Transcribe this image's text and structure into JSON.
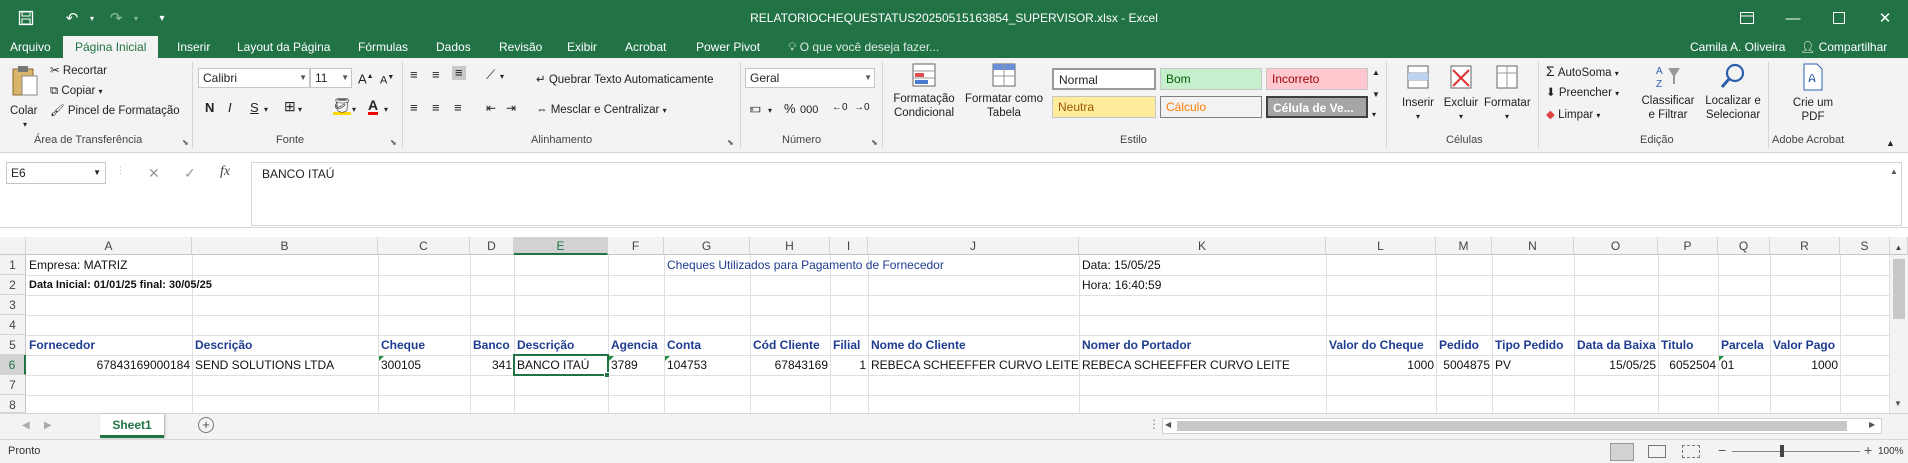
{
  "window": {
    "title": "RELATORIOCHEQUESTATUS20250515163854_SUPERVISOR.xlsx  -  Excel"
  },
  "tabs": [
    "Arquivo",
    "Página Inicial",
    "Inserir",
    "Layout da Página",
    "Fórmulas",
    "Dados",
    "Revisão",
    "Exibir",
    "Acrobat",
    "Power Pivot"
  ],
  "tell_me": "O que você deseja fazer...",
  "user": "Camila A. Oliveira",
  "share_label": "Compartilhar",
  "ribbon": {
    "clipboard": {
      "paste": "Colar",
      "cut": "Recortar",
      "copy": "Copiar",
      "painter": "Pincel de Formatação",
      "label": "Área de Transferência"
    },
    "font": {
      "name": "Calibri",
      "size": "11",
      "label": "Fonte",
      "bold": "N",
      "italic": "I",
      "underline": "S"
    },
    "alignment": {
      "wrap": "Quebrar Texto Automaticamente",
      "merge": "Mesclar e Centralizar",
      "label": "Alinhamento"
    },
    "number": {
      "format": "Geral",
      "label": "Número",
      "percent": "%",
      "thousands": "000"
    },
    "styles": {
      "cond_format": "Formatação Condicional",
      "format_table": "Formatar como Tabela",
      "normal": "Normal",
      "good": "Bom",
      "bad": "Incorreto",
      "neutral": "Neutra",
      "calc": "Cálculo",
      "check": "Célula de Ve...",
      "label": "Estilo"
    },
    "cells": {
      "insert": "Inserir",
      "delete": "Excluir",
      "format": "Formatar",
      "label": "Células"
    },
    "editing": {
      "autosum": "AutoSoma",
      "fill": "Preencher",
      "clear": "Limpar",
      "sort": "Classificar e Filtrar",
      "find": "Localizar e Selecionar",
      "label": "Edição"
    },
    "acrobat": {
      "create": "Crie um PDF",
      "label": "Adobe Acrobat"
    }
  },
  "formula_bar": {
    "name_box": "E6",
    "formula": "BANCO ITAÚ"
  },
  "columns": [
    "A",
    "B",
    "C",
    "D",
    "E",
    "F",
    "G",
    "H",
    "I",
    "J",
    "K",
    "L",
    "M",
    "N",
    "O",
    "P",
    "Q",
    "R",
    "S"
  ],
  "rows": [
    "1",
    "2",
    "3",
    "4",
    "5",
    "6",
    "7",
    "8"
  ],
  "cells": {
    "A1": "Empresa: MATRIZ",
    "G1": "Cheques Utilizados para Pagamento de Fornecedor",
    "K1": "Data: 15/05/25",
    "A2": "Data Inicial: 01/01/25 final: 30/05/25",
    "K2": "Hora: 16:40:59",
    "headers": [
      "Fornecedor",
      "Descrição",
      "Cheque",
      "Banco",
      "Descrição",
      "Agencia",
      "Conta",
      "Cód Cliente",
      "Filial",
      "Nome do Cliente",
      "Nomer do Portador",
      "Valor do Cheque",
      "Pedido",
      "Tipo Pedido",
      "Data da Baixa",
      "Titulo",
      "Parcela",
      "Valor Pago"
    ],
    "row6": [
      "67843169000184",
      "SEND SOLUTIONS LTDA",
      "300105",
      "341",
      "BANCO ITAÚ",
      "3789",
      "104753",
      "67843169",
      "1",
      "REBECA SCHEEFFER CURVO LEITE",
      "REBECA SCHEEFFER CURVO LEITE",
      "1000",
      "5004875",
      "PV",
      "15/05/25",
      "6052504",
      "01",
      "1000"
    ]
  },
  "sheet_tab": "Sheet1",
  "status": {
    "ready": "Pronto",
    "zoom": "100%"
  }
}
